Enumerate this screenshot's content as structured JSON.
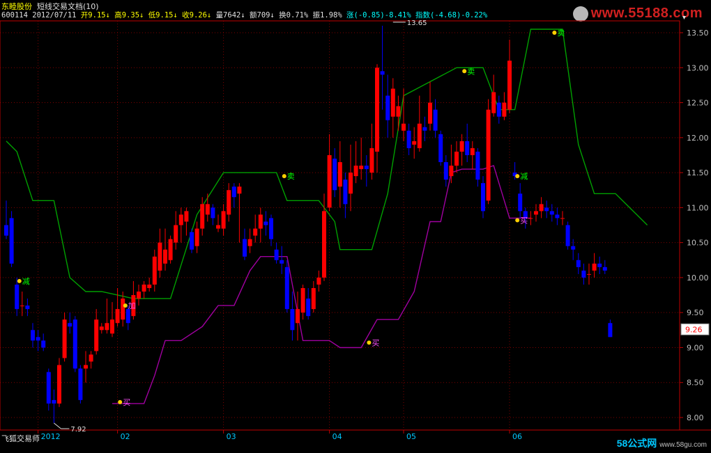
{
  "header": {
    "stock_name": "东睦股份",
    "indicator_name": "短线交易文档(10)",
    "code": "600114",
    "date": "2012/07/11",
    "open_label": "开9.15↓",
    "high_label": "高9.35↓",
    "low_label": "低9.15↓",
    "close_label": "收9.26↓",
    "volume_label": "量7642↓",
    "amount_label": "额709↓",
    "turnover_label": "换0.71%",
    "amplitude_label": "振1.98%",
    "change_label": "涨(-0.85)-8.41%",
    "index_label": "指数(-4.68)-0.22%"
  },
  "footer": {
    "left_label": "飞狐交易师",
    "watermark": "58公式网",
    "watermark_url": "www.58gu.com"
  },
  "watermark_top": "www.55188.com",
  "colors": {
    "background": "#000000",
    "up": "#ff0000",
    "down": "#0000ff",
    "resistance": "#00a000",
    "support": "#a000a0",
    "axis": "#c00000",
    "grid": "#800000",
    "text": "#c0c0c0",
    "current_price_box": "#ffffff"
  },
  "chart_data": {
    "type": "candlestick",
    "ylim": [
      7.9,
      13.6
    ],
    "y_ticks": [
      "8.00",
      "8.50",
      "9.00",
      "9.50",
      "10.00",
      "10.50",
      "11.00",
      "11.50",
      "12.00",
      "12.50",
      "13.00",
      "13.50"
    ],
    "x_ticks": [
      {
        "label": "2012",
        "index": 6
      },
      {
        "label": "02",
        "index": 21
      },
      {
        "label": "03",
        "index": 41
      },
      {
        "label": "04",
        "index": 61
      },
      {
        "label": "05",
        "index": 75
      },
      {
        "label": "06",
        "index": 95
      }
    ],
    "current_price": "9.26",
    "max_label": "13.65",
    "min_label": "7.92",
    "max_index": 73,
    "min_index": 9,
    "candles": [
      [
        10.75,
        10.6,
        11.1,
        10.55
      ],
      [
        10.85,
        10.2,
        10.95,
        10.15
      ],
      [
        9.9,
        9.55,
        10.0,
        9.45
      ],
      [
        9.6,
        9.6,
        9.8,
        9.45
      ],
      [
        9.6,
        9.55,
        9.7,
        9.45
      ],
      [
        9.25,
        9.1,
        9.35,
        9.0
      ],
      [
        9.15,
        9.1,
        9.25,
        8.95
      ],
      [
        9.1,
        9.0,
        9.2,
        8.95
      ],
      [
        8.65,
        8.2,
        8.7,
        8.1
      ],
      [
        8.25,
        8.2,
        8.4,
        7.92
      ],
      [
        8.2,
        8.75,
        8.85,
        8.15
      ],
      [
        8.85,
        9.4,
        9.5,
        8.8
      ],
      [
        9.35,
        9.3,
        9.5,
        9.2
      ],
      [
        9.4,
        8.7,
        9.45,
        8.65
      ],
      [
        8.7,
        8.25,
        8.75,
        8.2
      ],
      [
        8.7,
        8.75,
        8.95,
        8.5
      ],
      [
        8.8,
        8.9,
        8.95,
        8.7
      ],
      [
        8.95,
        9.4,
        9.55,
        8.9
      ],
      [
        9.25,
        9.3,
        9.35,
        9.2
      ],
      [
        9.25,
        9.35,
        9.7,
        9.2
      ],
      [
        9.2,
        9.4,
        9.65,
        9.15
      ],
      [
        9.35,
        9.55,
        9.85,
        9.3
      ],
      [
        9.4,
        9.7,
        9.8,
        9.3
      ],
      [
        9.55,
        9.35,
        9.6,
        9.25
      ],
      [
        9.45,
        9.75,
        9.95,
        9.4
      ],
      [
        9.7,
        9.8,
        9.9,
        9.6
      ],
      [
        9.8,
        9.9,
        9.95,
        9.7
      ],
      [
        9.85,
        9.9,
        10.0,
        9.8
      ],
      [
        9.9,
        10.3,
        10.4,
        9.8
      ],
      [
        10.1,
        10.5,
        10.7,
        10.0
      ],
      [
        10.2,
        10.4,
        10.7,
        10.1
      ],
      [
        10.25,
        10.55,
        10.6,
        10.2
      ],
      [
        10.5,
        10.75,
        10.95,
        10.4
      ],
      [
        10.75,
        10.9,
        11.0,
        10.5
      ],
      [
        10.8,
        10.95,
        11.0,
        10.6
      ],
      [
        10.65,
        10.4,
        10.7,
        10.35
      ],
      [
        10.45,
        10.7,
        10.8,
        10.35
      ],
      [
        10.7,
        11.05,
        11.15,
        10.6
      ],
      [
        10.9,
        11.05,
        11.2,
        10.8
      ],
      [
        11.0,
        10.85,
        11.05,
        10.75
      ],
      [
        10.7,
        10.75,
        10.9,
        10.65
      ],
      [
        10.7,
        10.95,
        11.05,
        10.6
      ],
      [
        10.9,
        11.25,
        11.35,
        10.8
      ],
      [
        11.3,
        11.15,
        11.35,
        11.0
      ],
      [
        11.2,
        11.3,
        11.35,
        10.5
      ],
      [
        10.55,
        10.3,
        10.7,
        10.25
      ],
      [
        10.45,
        10.55,
        10.7,
        10.35
      ],
      [
        10.6,
        10.7,
        10.9,
        10.5
      ],
      [
        10.7,
        10.9,
        11.0,
        10.5
      ],
      [
        10.8,
        10.75,
        10.95,
        10.6
      ],
      [
        10.85,
        10.55,
        10.9,
        10.45
      ],
      [
        10.4,
        10.25,
        10.5,
        10.2
      ],
      [
        10.25,
        10.2,
        10.45,
        10.05
      ],
      [
        10.15,
        9.55,
        10.25,
        9.5
      ],
      [
        9.55,
        9.25,
        9.8,
        9.1
      ],
      [
        9.35,
        9.55,
        9.8,
        9.1
      ],
      [
        9.5,
        9.85,
        9.9,
        9.4
      ],
      [
        9.7,
        9.45,
        9.85,
        9.4
      ],
      [
        9.55,
        9.85,
        9.95,
        9.5
      ],
      [
        9.9,
        10.0,
        10.1,
        9.8
      ],
      [
        10.0,
        10.95,
        11.2,
        9.95
      ],
      [
        11.0,
        11.75,
        12.05,
        10.95
      ],
      [
        11.7,
        11.25,
        11.85,
        11.15
      ],
      [
        11.3,
        11.65,
        11.95,
        11.0
      ],
      [
        11.4,
        11.05,
        11.5,
        10.85
      ],
      [
        11.2,
        11.5,
        11.9,
        10.95
      ],
      [
        11.45,
        11.6,
        11.95,
        11.35
      ],
      [
        11.55,
        11.6,
        12.0,
        11.4
      ],
      [
        11.6,
        11.55,
        11.75,
        11.3
      ],
      [
        11.5,
        11.85,
        12.2,
        11.4
      ],
      [
        11.8,
        13.0,
        13.05,
        11.5
      ],
      [
        12.95,
        12.9,
        13.6,
        12.4
      ],
      [
        12.6,
        12.25,
        12.9,
        12.0
      ],
      [
        12.3,
        12.7,
        12.85,
        12.0
      ],
      [
        12.3,
        12.45,
        12.6,
        12.1
      ],
      [
        12.1,
        12.2,
        12.7,
        11.95
      ],
      [
        12.1,
        11.85,
        12.2,
        11.75
      ],
      [
        11.9,
        11.95,
        12.15,
        11.7
      ],
      [
        11.85,
        12.2,
        12.6,
        11.8
      ],
      [
        12.15,
        12.1,
        12.3,
        11.95
      ],
      [
        12.2,
        12.5,
        12.8,
        12.1
      ],
      [
        12.4,
        12.1,
        12.55,
        12.0
      ],
      [
        12.05,
        11.65,
        12.1,
        11.6
      ],
      [
        11.65,
        11.4,
        11.75,
        11.3
      ],
      [
        11.45,
        11.6,
        11.9,
        11.35
      ],
      [
        11.6,
        11.8,
        11.95,
        11.5
      ],
      [
        11.8,
        11.95,
        12.05,
        11.6
      ],
      [
        11.95,
        11.75,
        12.2,
        11.65
      ],
      [
        11.75,
        11.85,
        11.95,
        11.55
      ],
      [
        11.8,
        11.4,
        11.85,
        11.3
      ],
      [
        11.35,
        10.95,
        11.45,
        10.85
      ],
      [
        11.1,
        12.4,
        12.55,
        11.05
      ],
      [
        12.35,
        12.65,
        12.9,
        12.3
      ],
      [
        12.5,
        12.3,
        12.6,
        12.2
      ],
      [
        12.3,
        12.5,
        12.65,
        12.25
      ],
      [
        12.4,
        13.1,
        13.4,
        12.35
      ],
      [
        11.5,
        11.45,
        11.65,
        11.4
      ],
      [
        11.2,
        10.95,
        11.35,
        10.85
      ],
      [
        10.95,
        10.85,
        11.0,
        10.7
      ],
      [
        10.85,
        10.85,
        10.95,
        10.75
      ],
      [
        10.9,
        10.95,
        11.05,
        10.8
      ],
      [
        10.95,
        11.05,
        11.15,
        10.85
      ],
      [
        11.0,
        10.95,
        11.1,
        10.85
      ],
      [
        10.95,
        10.9,
        11.05,
        10.8
      ],
      [
        10.9,
        10.85,
        11.0,
        10.75
      ],
      [
        10.85,
        10.85,
        10.95,
        10.75
      ],
      [
        10.75,
        10.45,
        10.8,
        10.4
      ],
      [
        10.45,
        10.4,
        10.55,
        10.25
      ],
      [
        10.25,
        10.15,
        10.35,
        10.05
      ],
      [
        10.1,
        10.0,
        10.2,
        9.9
      ],
      [
        10.05,
        10.05,
        10.2,
        9.9
      ],
      [
        10.1,
        10.2,
        10.35,
        10.0
      ],
      [
        10.2,
        10.15,
        10.3,
        10.05
      ],
      [
        10.15,
        10.1,
        10.25,
        10.05
      ],
      [
        9.35,
        9.15,
        9.4,
        9.15
      ]
    ],
    "resistance_line": [
      [
        0,
        11.95
      ],
      [
        2,
        11.8
      ],
      [
        5,
        11.1
      ],
      [
        9,
        11.1
      ],
      [
        12,
        10.0
      ],
      [
        15,
        9.8
      ],
      [
        18,
        9.8
      ],
      [
        24,
        9.7
      ],
      [
        29,
        9.7
      ],
      [
        31,
        9.7
      ],
      [
        36,
        10.9
      ],
      [
        41,
        11.5
      ],
      [
        46,
        11.5
      ],
      [
        51,
        11.5
      ],
      [
        53,
        11.1
      ],
      [
        59,
        11.1
      ],
      [
        62,
        10.8
      ],
      [
        63,
        10.4
      ],
      [
        66,
        10.4
      ],
      [
        69,
        10.4
      ],
      [
        72,
        11.2
      ],
      [
        75,
        12.6
      ],
      [
        80,
        12.8
      ],
      [
        85,
        13.0
      ],
      [
        90,
        13.0
      ],
      [
        93,
        12.4
      ],
      [
        96,
        12.4
      ],
      [
        99,
        13.55
      ],
      [
        105,
        13.55
      ],
      [
        108,
        11.9
      ],
      [
        111,
        11.2
      ],
      [
        115,
        11.2
      ],
      [
        119,
        10.9
      ],
      [
        121,
        10.75
      ]
    ],
    "support_line": [
      [
        20,
        8.2
      ],
      [
        26,
        8.2
      ],
      [
        28,
        8.6
      ],
      [
        30,
        9.1
      ],
      [
        33,
        9.1
      ],
      [
        37,
        9.3
      ],
      [
        40,
        9.6
      ],
      [
        43,
        9.6
      ],
      [
        46,
        10.1
      ],
      [
        48,
        10.3
      ],
      [
        51,
        10.3
      ],
      [
        53,
        10.3
      ],
      [
        56,
        9.1
      ],
      [
        61,
        9.1
      ],
      [
        63,
        9.0
      ],
      [
        67,
        9.0
      ],
      [
        70,
        9.4
      ],
      [
        74,
        9.4
      ],
      [
        77,
        9.8
      ],
      [
        80,
        10.8
      ],
      [
        82,
        10.8
      ],
      [
        84,
        11.5
      ],
      [
        86,
        11.55
      ],
      [
        88,
        11.55
      ],
      [
        90,
        11.55
      ],
      [
        92,
        11.6
      ],
      [
        95,
        10.85
      ],
      [
        99,
        10.85
      ]
    ],
    "signals": [
      {
        "index": 3,
        "price": 9.95,
        "label": "减",
        "color": "#00ff00"
      },
      {
        "index": 23,
        "price": 9.6,
        "label": "加",
        "color": "#ff50ff"
      },
      {
        "index": 22,
        "price": 8.22,
        "label": "买",
        "color": "#ff50ff"
      },
      {
        "index": 53,
        "price": 11.45,
        "label": "卖",
        "color": "#00ff00"
      },
      {
        "index": 69,
        "price": 9.07,
        "label": "买",
        "color": "#ff50ff"
      },
      {
        "index": 87,
        "price": 12.95,
        "label": "卖",
        "color": "#00ff00"
      },
      {
        "index": 97,
        "price": 11.45,
        "label": "减",
        "color": "#00ff00"
      },
      {
        "index": 97,
        "price": 10.82,
        "label": "买",
        "color": "#ff50ff"
      },
      {
        "index": 104,
        "price": 13.5,
        "label": "卖",
        "color": "#00ff00"
      }
    ]
  }
}
